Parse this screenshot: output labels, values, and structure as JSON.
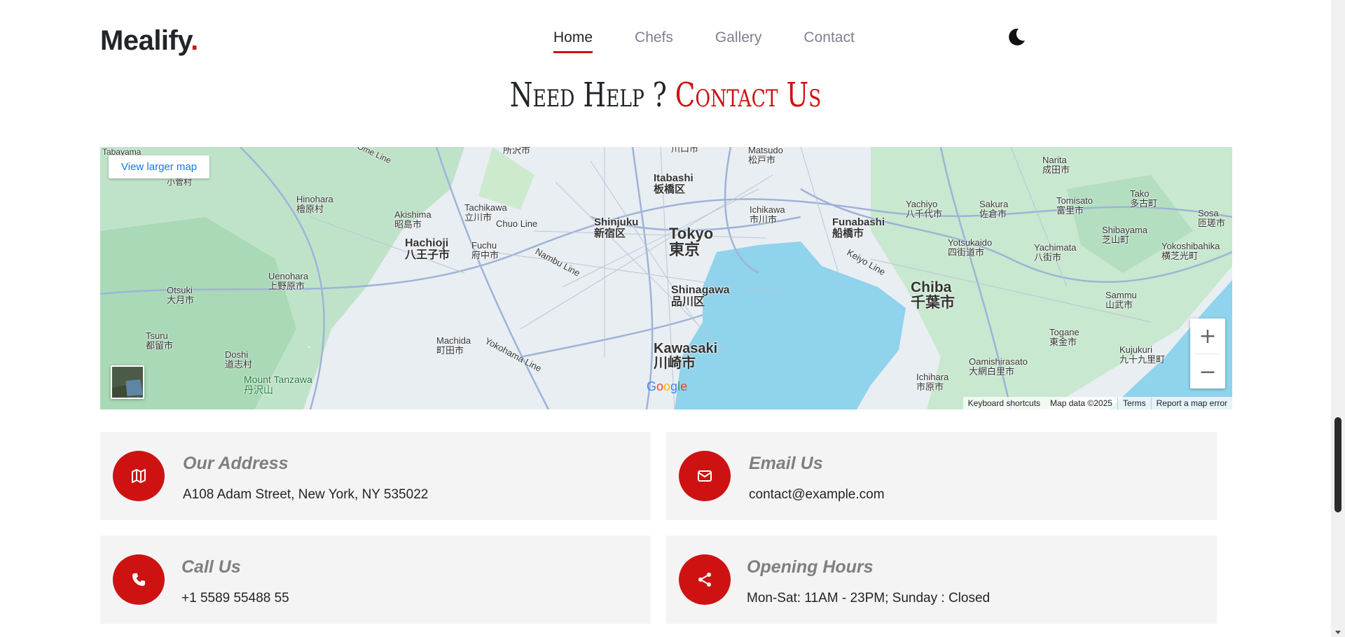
{
  "header": {
    "logo_text": "Mealify",
    "logo_dot": ".",
    "nav": [
      {
        "label": "Home",
        "active": true
      },
      {
        "label": "Chefs",
        "active": false
      },
      {
        "label": "Gallery",
        "active": false
      },
      {
        "label": "Contact",
        "active": false
      }
    ],
    "theme_icon": "moon-icon"
  },
  "section": {
    "title_part1": "Need Help ?",
    "title_part2": "Contact Us"
  },
  "map": {
    "larger_map_link": "View larger map",
    "zoom_in": "+",
    "zoom_out": "−",
    "google_logo": "Google",
    "footer": {
      "shortcuts": "Keyboard shortcuts",
      "map_data": "Map data ©2025",
      "terms": "Terms",
      "report": "Report a map error"
    },
    "labels": {
      "tokyo": "Tokyo",
      "tokyo_jp": "東京",
      "shinjuku": "Shinjuku",
      "shinjuku_jp": "新宿区",
      "itabashi": "Itabashi",
      "itabashi_jp": "板橋区",
      "shinagawa": "Shinagawa",
      "shinagawa_jp": "品川区",
      "kawasaki": "Kawasaki",
      "kawasaki_jp": "川崎市",
      "chiba": "Chiba",
      "chiba_jp": "千葉市",
      "funabashi": "Funabashi",
      "funabashi_jp": "船橋市",
      "hachioji": "Hachioji",
      "hachioji_jp": "八王子市",
      "machida": "Machida",
      "machida_jp": "町田市",
      "tachikawa": "Tachikawa",
      "tachikawa_jp": "立川市",
      "fuchu": "Fuchu",
      "fuchu_jp": "府中市",
      "akishima": "Akishima",
      "akishima_jp": "昭島市",
      "hinohara": "Hinohara",
      "hinohara_jp": "檜原村",
      "uenohara": "Uenohara",
      "uenohara_jp": "上野原市",
      "otsuki": "Otsuki",
      "otsuki_jp": "大月市",
      "tsuru": "Tsuru",
      "tsuru_jp": "都留市",
      "doshi": "Doshi",
      "doshi_jp": "道志村",
      "mount_tanzawa": "Mount Tanzawa",
      "mount_tanzawa_jp": "丹沢山",
      "ichikawa": "Ichikawa",
      "ichikawa_jp": "市川市",
      "matsudo": "Matsudo",
      "matsudo_jp": "松戸市",
      "yachiyo": "Yachiyo",
      "yachiyo_jp": "八千代市",
      "sakura": "Sakura",
      "sakura_jp": "佐倉市",
      "narita": "Narita",
      "narita_jp": "成田市",
      "tomisato": "Tomisato",
      "tomisato_jp": "富里市",
      "tako": "Tako",
      "tako_jp": "多古町",
      "yotsukaido": "Yotsukaido",
      "yotsukaido_jp": "四街道市",
      "yachimata": "Yachimata",
      "yachimata_jp": "八街市",
      "shibayama": "Shibayama",
      "shibayama_jp": "芝山町",
      "sosa": "Sosa",
      "sosa_jp": "匝瑳市",
      "yokoshibahikari": "Yokoshibahika",
      "yokoshibahikari_jp": "横芝光町",
      "sammu": "Sammu",
      "sammu_jp": "山武市",
      "togane": "Togane",
      "togane_jp": "東金市",
      "oamishirasato": "Oamishirasato",
      "oamishirasato_jp": "大網白里市",
      "kujukuri": "Kujukuri",
      "kujukuri_jp": "九十九里町",
      "ichihara": "Ichihara",
      "ichihara_jp": "市原市",
      "tabayama": "Tabayama",
      "kosuge": "小菅村",
      "chuo_line": "Chuo Line",
      "ome_line": "Ome Line",
      "nambu_line": "Nambu Line",
      "yokohama_line": "Yokohama Line",
      "keiyo_line": "Keiyo Line",
      "tokorozawa_jp": "所沢市",
      "kawaguchi_jp": "川口市"
    }
  },
  "info_cards": [
    {
      "title": "Our Address",
      "text": "A108 Adam Street, New York, NY 535022",
      "icon": "map-icon"
    },
    {
      "title": "Email Us",
      "text": "contact@example.com",
      "icon": "envelope-icon"
    },
    {
      "title": "Call Us",
      "text": "+1 5589 55488 55",
      "icon": "phone-icon"
    },
    {
      "title": "Opening Hours",
      "text": "Mon-Sat: 11AM - 23PM; Sunday : Closed",
      "icon": "share-icon"
    }
  ],
  "colors": {
    "accent": "#ce1212",
    "card_bg": "#f4f4f4",
    "water": "#8fd3ec",
    "land": "#e9eef2",
    "park": "#b7e1c6"
  }
}
